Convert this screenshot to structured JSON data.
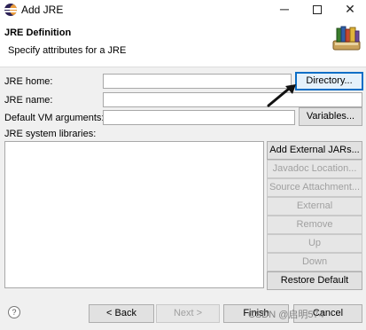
{
  "window": {
    "title": "Add JRE",
    "minimize_glyph": "─",
    "close_glyph": "✕"
  },
  "header": {
    "title": "JRE Definition",
    "subtitle": "Specify attributes for a JRE",
    "icon": "library-books-icon"
  },
  "form": {
    "jre_home_label": "JRE home:",
    "jre_home_value": "",
    "jre_name_label": "JRE name:",
    "jre_name_value": "",
    "vm_args_label": "Default VM arguments:",
    "vm_args_value": "",
    "directory_button": "Directory...",
    "variables_button": "Variables...",
    "libraries_label": "JRE system libraries:"
  },
  "library_buttons": {
    "add_external_jars": "Add External JARs...",
    "javadoc_location": "Javadoc Location...",
    "source_attachment": "Source Attachment...",
    "external_annotations": "External annotations...",
    "remove": "Remove",
    "up": "Up",
    "down": "Down",
    "restore_default": "Restore Default"
  },
  "footer": {
    "help_glyph": "?",
    "back": "< Back",
    "next": "Next >",
    "finish": "Finish",
    "cancel": "Cancel"
  },
  "watermark": "CSDN @启明574",
  "colors": {
    "focus_border": "#0b6ec6",
    "disabled_text": "#a0a0a0"
  }
}
